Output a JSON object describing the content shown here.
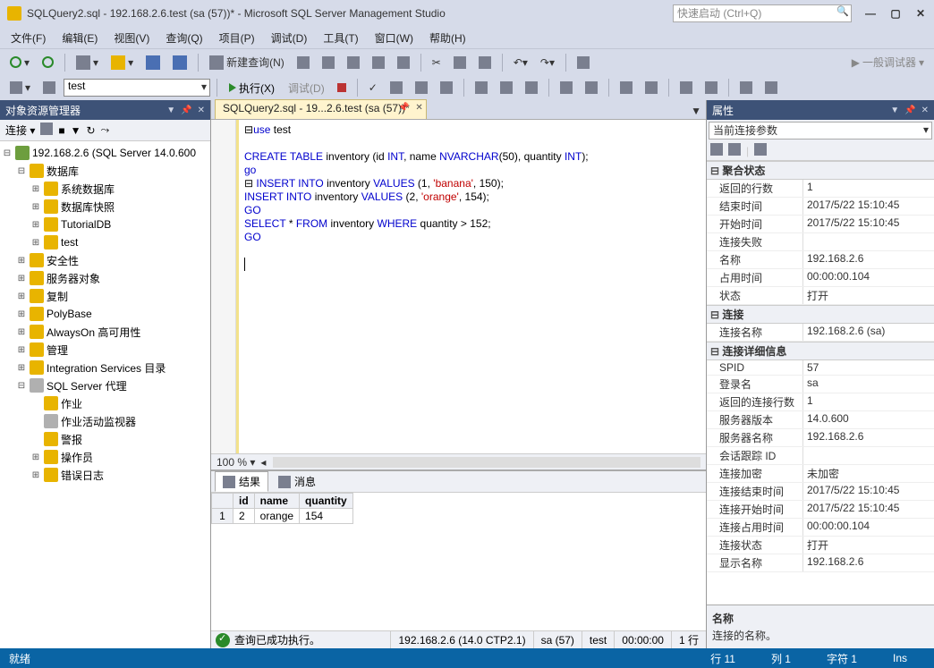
{
  "title": "SQLQuery2.sql - 192.168.2.6.test (sa (57))* - Microsoft SQL Server Management Studio",
  "quick_launch_placeholder": "快速启动 (Ctrl+Q)",
  "menus": {
    "file": "文件(F)",
    "edit": "编辑(E)",
    "view": "视图(V)",
    "query": "查询(Q)",
    "project": "项目(P)",
    "debug": "调试(D)",
    "tools": "工具(T)",
    "window": "窗口(W)",
    "help": "帮助(H)"
  },
  "toolbar": {
    "new_query": "新建查询(N)",
    "general_debugger": "一般调试器"
  },
  "toolbar2": {
    "db": "test",
    "execute": "执行(X)",
    "debug": "调试(D)"
  },
  "obj_explorer": {
    "title": "对象资源管理器",
    "connect": "连接",
    "server": "192.168.2.6 (SQL Server 14.0.600",
    "nodes": {
      "databases": "数据库",
      "sysdb": "系统数据库",
      "dbsnap": "数据库快照",
      "tutorial": "TutorialDB",
      "test": "test",
      "security": "安全性",
      "serverobj": "服务器对象",
      "replication": "复制",
      "polybase": "PolyBase",
      "alwayson": "AlwaysOn 高可用性",
      "management": "管理",
      "integration": "Integration Services 目录",
      "agent": "SQL Server 代理",
      "jobs": "作业",
      "jobmon": "作业活动监视器",
      "alerts": "警报",
      "operators": "操作员",
      "errorlog": "错误日志"
    }
  },
  "tab_label": "SQLQuery2.sql - 19...2.6.test (sa (57))*",
  "zoom": "100 %",
  "code": {
    "l1a": "use",
    "l1b": " test",
    "l3a": "CREATE TABLE",
    "l3b": " inventory ",
    "l3c": "(",
    "l3d": "id ",
    "l3e": "INT",
    "l3f": ", ",
    "l3g": "name ",
    "l3h": "NVARCHAR",
    "l3i": "(",
    "l3j": "50",
    "l3k": "),",
    "l3l": " quantity ",
    "l3m": "INT",
    "l3n": ");",
    "l4": "go",
    "l5a": " INSERT INTO",
    "l5b": " inventory ",
    "l5c": "VALUES ",
    "l5d": "(",
    "l5e": "1",
    "l5f": ", ",
    "l5g": "'banana'",
    "l5h": ", ",
    "l5i": "150",
    "l5j": ");",
    "l6a": "INSERT INTO",
    "l6b": " inventory ",
    "l6c": "VALUES ",
    "l6d": "(",
    "l6e": "2",
    "l6f": ", ",
    "l6g": "'orange'",
    "l6h": ", ",
    "l6i": "154",
    "l6j": ");",
    "l7": "GO",
    "l8a": "SELECT ",
    "l8b": "* ",
    "l8c": "FROM",
    "l8d": " inventory ",
    "l8e": "WHERE",
    "l8f": " quantity ",
    "l8g": ">",
    "l8h": " 152",
    "l8i": ";",
    "l9": "GO"
  },
  "results": {
    "tab_results": "结果",
    "tab_messages": "消息",
    "headers": {
      "id": "id",
      "name": "name",
      "quantity": "quantity"
    },
    "row1": {
      "n": "1",
      "id": "2",
      "name": "orange",
      "quantity": "154"
    }
  },
  "status2": {
    "ok": "查询已成功执行。",
    "server": "192.168.2.6 (14.0 CTP2.1)",
    "user": "sa (57)",
    "db": "test",
    "time": "00:00:00",
    "rows": "1 行"
  },
  "props": {
    "title": "属性",
    "sub": "当前连接参数",
    "cat_agg": "聚合状态",
    "rows_returned_k": "返回的行数",
    "rows_returned_v": "1",
    "end_time_k": "结束时间",
    "end_time_v": "2017/5/22 15:10:45",
    "start_time_k": "开始时间",
    "start_time_v": "2017/5/22 15:10:45",
    "conn_fail_k": "连接失败",
    "conn_fail_v": "",
    "name_k": "名称",
    "name_v": "192.168.2.6",
    "busy_time_k": "占用时间",
    "busy_time_v": "00:00:00.104",
    "state_k": "状态",
    "state_v": "打开",
    "cat_conn": "连接",
    "conn_name_k": "连接名称",
    "conn_name_v": "192.168.2.6 (sa)",
    "cat_conndetail": "连接详细信息",
    "spid_k": "SPID",
    "spid_v": "57",
    "login_k": "登录名",
    "login_v": "sa",
    "ret_rows_k": "返回的连接行数",
    "ret_rows_v": "1",
    "srv_ver_k": "服务器版本",
    "srv_ver_v": "14.0.600",
    "srv_name_k": "服务器名称",
    "srv_name_v": "192.168.2.6",
    "sess_trace_k": "会话跟踪 ID",
    "sess_trace_v": "",
    "conn_enc_k": "连接加密",
    "conn_enc_v": "未加密",
    "conn_end_k": "连接结束时间",
    "conn_end_v": "2017/5/22 15:10:45",
    "conn_start_k": "连接开始时间",
    "conn_start_v": "2017/5/22 15:10:45",
    "conn_busy_k": "连接占用时间",
    "conn_busy_v": "00:00:00.104",
    "conn_state_k": "连接状态",
    "conn_state_v": "打开",
    "disp_name_k": "显示名称",
    "disp_name_v": "192.168.2.6",
    "desc_name": "名称",
    "desc_text": "连接的名称。"
  },
  "statusbar": {
    "ready": "就绪",
    "line": "行 11",
    "col": "列 1",
    "char": "字符 1",
    "ins": "Ins"
  }
}
